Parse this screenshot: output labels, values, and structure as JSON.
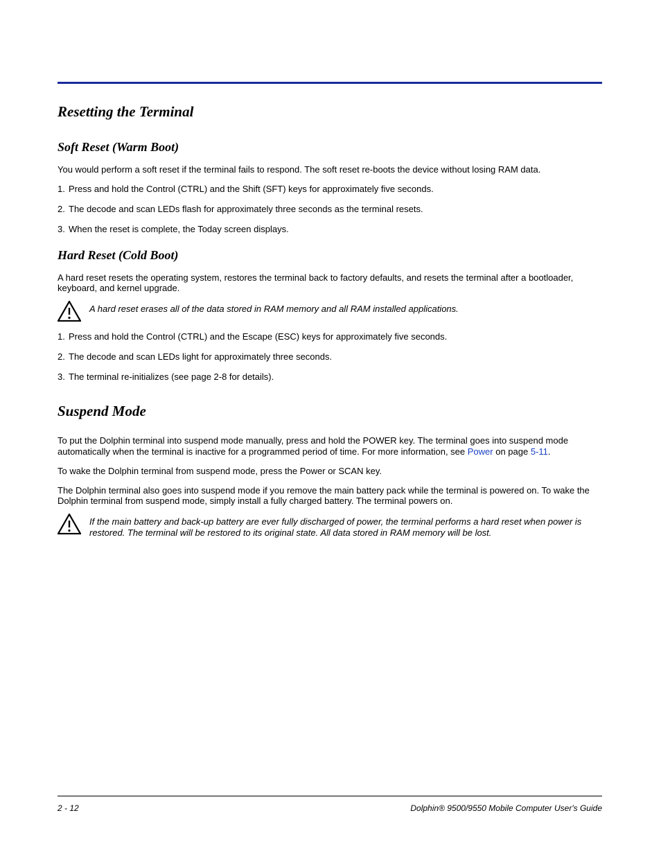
{
  "sections": {
    "resetting": {
      "title": "Resetting the Terminal",
      "soft": {
        "title": "Soft Reset (Warm Boot)",
        "intro": "You would perform a soft reset if the terminal fails to respond. The soft reset re-boots the device without losing RAM data.",
        "steps": [
          "Press and hold the Control (CTRL) and the Shift (SFT) keys for approximately five seconds.",
          "The decode and scan LEDs flash for approximately three seconds as the terminal resets.",
          "When the reset is complete, the Today screen displays."
        ]
      },
      "hard": {
        "title": "Hard Reset (Cold Boot)",
        "intro": "A hard reset resets the operating system, restores the terminal back to factory defaults, and resets the terminal after a bootloader, keyboard, and kernel upgrade.",
        "note": "A hard reset erases all of the data stored in RAM memory and all RAM installed applications.",
        "steps": [
          "Press and hold the Control (CTRL) and the Escape (ESC) keys for approximately five seconds.",
          "The decode and scan LEDs light for approximately three seconds.",
          " The terminal re-initializes (see page 2-8 for details)."
        ]
      }
    },
    "suspend": {
      "title": "Suspend Mode",
      "p1_a": "To put the Dolphin terminal into suspend mode manually, press and hold the POWER key. The terminal goes into suspend mode automatically when the terminal is inactive for a programmed period of time. For more information, see ",
      "p1_link1": "Power",
      "p1_b": " on page ",
      "p1_link2": "5-11",
      "p1_c": ".",
      "p2": "To wake the Dolphin terminal from suspend mode, press the Power or SCAN key.",
      "p3": "The Dolphin terminal also goes into suspend mode if you remove the main battery pack while the terminal is powered on. To wake the Dolphin terminal from suspend mode, simply install a fully charged battery. The terminal powers on.",
      "note": "If the main battery and back-up battery are ever fully discharged of power, the terminal performs a hard reset when power is restored. The terminal will be restored to its original state. All data stored in RAM memory will be lost."
    }
  },
  "footer": {
    "left": "2 - 12",
    "right": "Dolphin® 9500/9550 Mobile Computer User's Guide"
  }
}
